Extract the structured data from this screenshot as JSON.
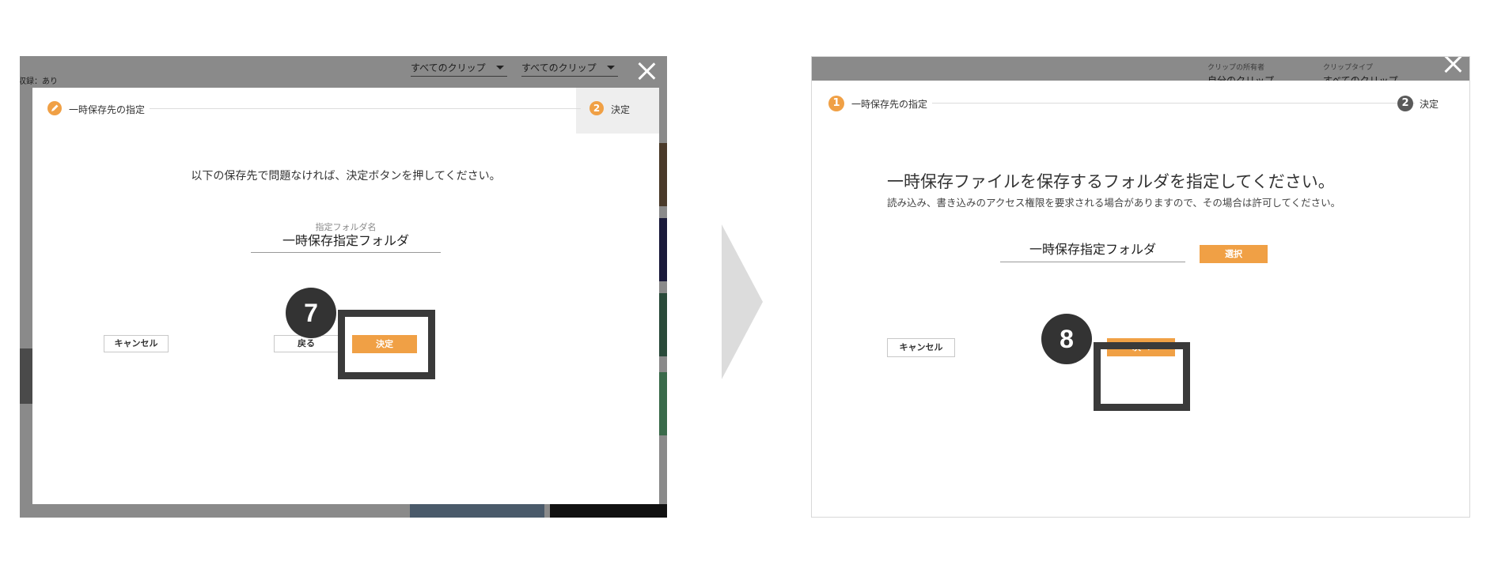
{
  "left": {
    "background": {
      "top_left_label": "収録：あり",
      "filter1_value": "すべてのクリップ",
      "filter2_value": "すべてのクリップ"
    },
    "stepper": {
      "step1_label": "一時保存先の指定",
      "step2_number": "2",
      "step2_label": "決定"
    },
    "message": "以下の保存先で問題なければ、決定ボタンを押してください。",
    "folder_caption": "指定フォルダ名",
    "folder_name": "一時保存指定フォルダ",
    "buttons": {
      "cancel": "キャンセル",
      "back": "戻る",
      "confirm": "決定"
    },
    "callout_number": "7"
  },
  "right": {
    "background": {
      "filter1_label": "クリップの所有者",
      "filter1_value": "自分のクリップ",
      "filter2_label": "クリップタイプ",
      "filter2_value": "すべてのクリップ"
    },
    "stepper": {
      "step1_number": "1",
      "step1_label": "一時保存先の指定",
      "step2_number": "2",
      "step2_label": "決定"
    },
    "heading": "一時保存ファイルを保存するフォルダを指定してください。",
    "subtext": "読み込み、書き込みのアクセス権限を要求される場合がありますので、その場合は許可してください。",
    "folder_name": "一時保存指定フォルダ",
    "buttons": {
      "select": "選択",
      "cancel": "キャンセル",
      "next": "次へ"
    },
    "callout_number": "8"
  },
  "colors": {
    "accent": "#f0a045",
    "callout": "#333333",
    "overlay": "#8a8a8a"
  }
}
